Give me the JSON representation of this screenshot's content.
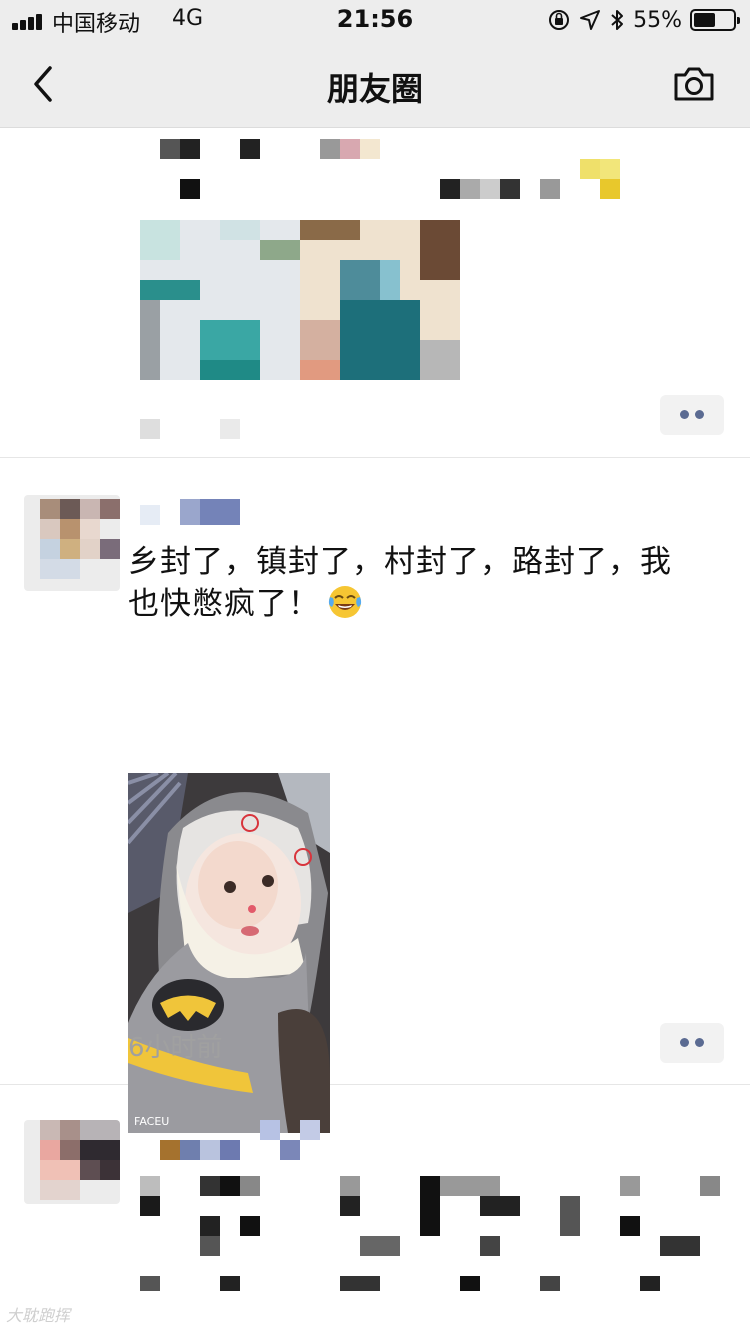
{
  "status_bar": {
    "carrier": "中国移动",
    "network": "4G",
    "time": "21:56",
    "battery_percent": "55%",
    "battery_level": 0.55,
    "icons": [
      "signal-icon",
      "orientation-lock-icon",
      "location-icon",
      "bluetooth-icon",
      "battery-icon"
    ]
  },
  "nav": {
    "title": "朋友圈",
    "back_icon": "chevron-left-icon",
    "camera_icon": "camera-icon"
  },
  "moments": [
    {
      "author": "",
      "text": "",
      "time": "",
      "more_icon": "more-dots-icon"
    },
    {
      "author": "",
      "text_line1": "乡封了，镇封了，村封了，路封了，我",
      "text_line2": "也快憋疯了！",
      "emoji": "face-with-tears-of-joy-icon",
      "photo_caption": "FACEU",
      "time": "6小时前",
      "more_icon": "more-dots-icon"
    },
    {
      "author": "",
      "text": ""
    }
  ],
  "watermark": "大耽跑挥",
  "colors": {
    "nav_background": "#ededed",
    "more_dots": "#5b6b92",
    "timestamp": "#a0a0a0"
  }
}
